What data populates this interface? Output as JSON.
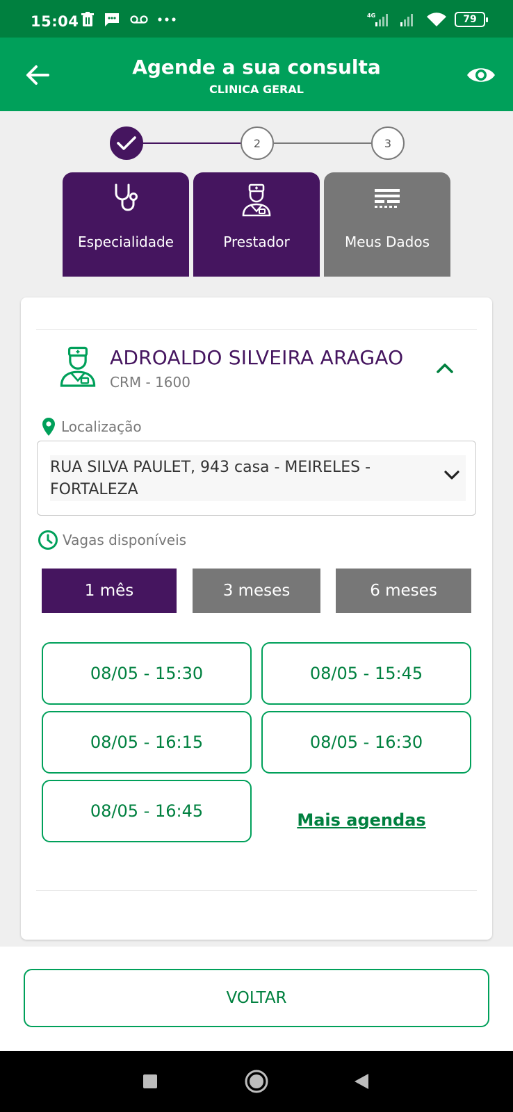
{
  "status_bar": {
    "time": "15:04",
    "network": "4G",
    "battery": "79",
    "icons": [
      "trash-icon",
      "message-icon",
      "voicemail-icon",
      "more-dots-icon",
      "signal-icon",
      "wifi-icon",
      "battery-icon"
    ]
  },
  "header": {
    "title": "Agende a sua consulta",
    "subtitle": "CLINICA GERAL",
    "back_icon": "arrow-left-icon",
    "eye_icon": "eye-icon"
  },
  "stepper": {
    "steps": [
      {
        "label": "",
        "state": "done"
      },
      {
        "label": "2",
        "state": "pending"
      },
      {
        "label": "3",
        "state": "pending"
      }
    ]
  },
  "categories": [
    {
      "label": "Especialidade",
      "icon": "stethoscope-icon",
      "state": "active"
    },
    {
      "label": "Prestador",
      "icon": "doctor-icon",
      "state": "active"
    },
    {
      "label": "Meus Dados",
      "icon": "data-form-icon",
      "state": "inactive"
    }
  ],
  "provider": {
    "name": "ADROALDO SILVEIRA ARAGAO",
    "crm": "CRM - 1600",
    "icon": "doctor-icon"
  },
  "location": {
    "label": "Localização",
    "value": "RUA SILVA PAULET, 943 casa - MEIRELES - FORTALEZA"
  },
  "availability": {
    "label": "Vagas disponíveis",
    "periods": [
      {
        "label": "1 mês",
        "state": "active"
      },
      {
        "label": "3 meses",
        "state": "inactive"
      },
      {
        "label": "6 meses",
        "state": "inactive"
      }
    ],
    "slots": [
      "08/05 - 15:30",
      "08/05 - 15:45",
      "08/05 - 16:15",
      "08/05 - 16:30",
      "08/05 - 16:45"
    ],
    "more_link": "Mais agendas"
  },
  "footer": {
    "back_button": "VOLTAR"
  },
  "colors": {
    "status_bar": "#00803f",
    "app_bar": "#00a05a",
    "purple": "#45155f",
    "gray": "#777777",
    "green_text": "#00803f"
  }
}
